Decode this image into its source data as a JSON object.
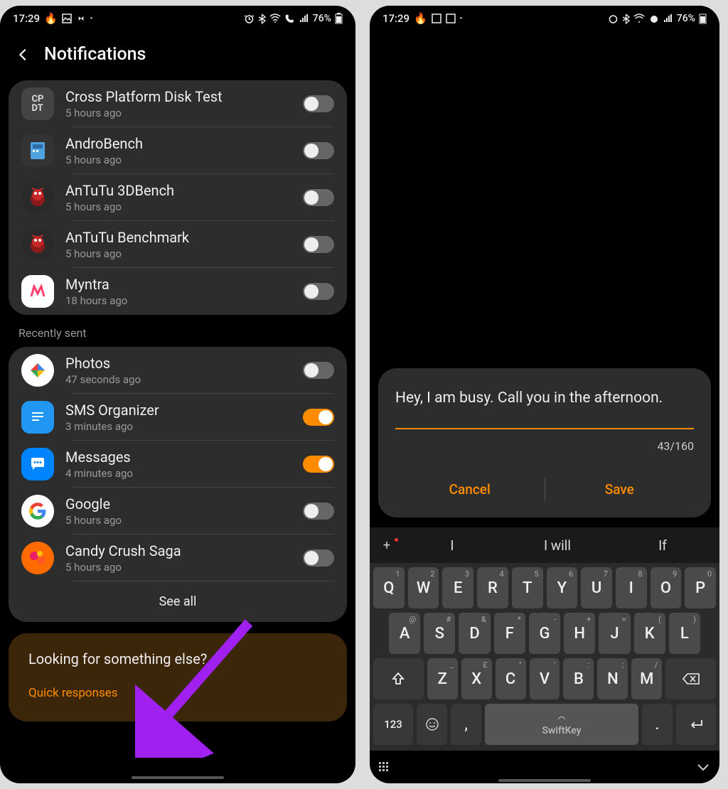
{
  "status": {
    "time": "17:29",
    "battery": "76%"
  },
  "left": {
    "title": "Notifications",
    "section_label": "Recently sent",
    "see_all": "See all",
    "promo_title": "Looking for something else?",
    "promo_link": "Quick responses",
    "apps_top": [
      {
        "name": "Cross Platform Disk Test",
        "time": "5 hours ago"
      },
      {
        "name": "AndroBench",
        "time": "5 hours ago"
      },
      {
        "name": "AnTuTu 3DBench",
        "time": "5 hours ago"
      },
      {
        "name": "AnTuTu Benchmark",
        "time": "5 hours ago"
      },
      {
        "name": "Myntra",
        "time": "18 hours ago"
      }
    ],
    "apps_recent": [
      {
        "name": "Photos",
        "time": "47 seconds ago",
        "on": false
      },
      {
        "name": "SMS Organizer",
        "time": "3 minutes ago",
        "on": true
      },
      {
        "name": "Messages",
        "time": "4 minutes ago",
        "on": true
      },
      {
        "name": "Google",
        "time": "5 hours ago",
        "on": false
      },
      {
        "name": "Candy Crush Saga",
        "time": "5 hours ago",
        "on": false
      }
    ]
  },
  "right": {
    "input_text": "Hey, I am busy. Call you in the afternoon.",
    "char_count": "43/160",
    "cancel": "Cancel",
    "save": "Save",
    "suggest": [
      "I",
      "I will",
      "If"
    ],
    "row1": [
      {
        "k": "Q",
        "s": "1"
      },
      {
        "k": "W",
        "s": "2"
      },
      {
        "k": "E",
        "s": "3"
      },
      {
        "k": "R",
        "s": "4"
      },
      {
        "k": "T",
        "s": "5"
      },
      {
        "k": "Y",
        "s": "6"
      },
      {
        "k": "U",
        "s": "7"
      },
      {
        "k": "I",
        "s": "8"
      },
      {
        "k": "O",
        "s": "9"
      },
      {
        "k": "P",
        "s": "0"
      }
    ],
    "row2": [
      {
        "k": "A",
        "s": "@"
      },
      {
        "k": "S",
        "s": "#"
      },
      {
        "k": "D",
        "s": "&"
      },
      {
        "k": "F",
        "s": "*"
      },
      {
        "k": "G",
        "s": "-"
      },
      {
        "k": "H",
        "s": "+"
      },
      {
        "k": "J",
        "s": "="
      },
      {
        "k": "K",
        "s": "("
      },
      {
        "k": "L",
        "s": ")"
      }
    ],
    "row3": [
      {
        "k": "Z",
        "s": "_"
      },
      {
        "k": "X",
        "s": "£"
      },
      {
        "k": "C",
        "s": "\""
      },
      {
        "k": "V",
        "s": "'"
      },
      {
        "k": "B",
        "s": ":"
      },
      {
        "k": "N",
        "s": ";"
      },
      {
        "k": "M",
        "s": "/"
      }
    ],
    "numKey": "123",
    "spaceLabel": "SwiftKey",
    "period": ".",
    "comma": ","
  }
}
